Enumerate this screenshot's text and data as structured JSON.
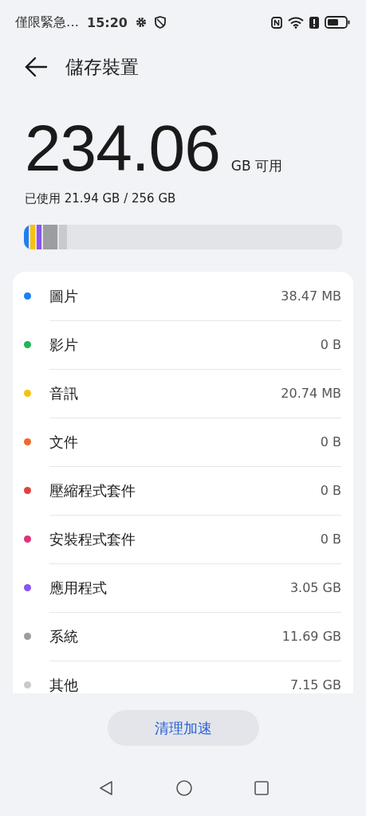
{
  "status_bar": {
    "carrier": "僅限緊急…",
    "time": "15:20"
  },
  "header": {
    "title": "儲存裝置"
  },
  "summary": {
    "available": "234.06",
    "available_unit": "GB 可用",
    "used": "已使用 21.94 GB / 256 GB"
  },
  "usage_bar": {
    "segments": [
      {
        "color": "#1e7ff0"
      },
      {
        "color": "#f8c20c"
      },
      {
        "color": "#8a55ee"
      },
      {
        "color": "#9c9da1"
      },
      {
        "color": "#c9cacd"
      }
    ]
  },
  "categories": [
    {
      "name": "圖片",
      "size": "38.47 MB",
      "color": "#1e7ff0"
    },
    {
      "name": "影片",
      "size": "0 B",
      "color": "#22b558"
    },
    {
      "name": "音訊",
      "size": "20.74 MB",
      "color": "#f8c20c"
    },
    {
      "name": "文件",
      "size": "0 B",
      "color": "#ee6a2c"
    },
    {
      "name": "壓縮程式套件",
      "size": "0 B",
      "color": "#e2423a"
    },
    {
      "name": "安裝程式套件",
      "size": "0 B",
      "color": "#e0307e"
    },
    {
      "name": "應用程式",
      "size": "3.05 GB",
      "color": "#8a55ee"
    },
    {
      "name": "系統",
      "size": "11.69 GB",
      "color": "#9c9da1"
    },
    {
      "name": "其他",
      "size": "7.15 GB",
      "color": "#c9cacd"
    }
  ],
  "action_button": {
    "label": "清理加速"
  }
}
